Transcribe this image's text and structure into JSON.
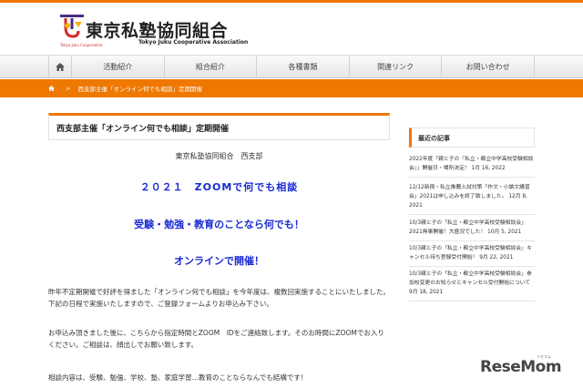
{
  "header": {
    "logo_title": "東京私塾協同組合",
    "logo_subtitle": "Tokyo Juku Cooperative Association",
    "logo_tag": "Tokyo Juku Cooperative"
  },
  "nav": {
    "home_icon": "home-icon",
    "items": [
      {
        "label": "活動紹介"
      },
      {
        "label": "組合紹介"
      },
      {
        "label": "各種書類"
      },
      {
        "label": "関連リンク"
      },
      {
        "label": "お問い合わせ"
      }
    ]
  },
  "breadcrumb": {
    "separator": ">",
    "current": "西支部主催「オンライン何でも相談」定期開催"
  },
  "article": {
    "title": "西支部主催「オンライン何でも相談」定期開催",
    "org": "東京私塾協同組合　西支部",
    "headline1": "２０２１　ZOOMで何でも相談",
    "headline2": "受験・勉強・教育のことなら何でも！",
    "headline3": "オンラインで開催！",
    "para1": "昨年不定期開催で好評を得ました「オンライン何でも相談」を今年度は、複数回実施することにいたしました。下記の日程で実施いたしますので、ご登録フォームよりお申込み下さい。",
    "para2": "お申込み頂きました後に、こちらから指定時間とZOOM　IDをご連絡致します。そのお時間にZOOMでお入りください。ご相談は、顔出しでお願い致します。",
    "para3": "相談内容は、受験、勉強、学校、塾、家庭学習…教育のことならなんでも結構です！"
  },
  "sidebar": {
    "title": "最近の記事",
    "items": [
      {
        "text": "2022年度「親と子の『私立・都立中学高校受験相談会』」開催日・場所決定！ 1月 16, 2022"
      },
      {
        "text": "12/12新宿・私立推薦入試対策「作文・小論文講習会」2021は申し込みを終了致しました。 12月 8, 2021"
      },
      {
        "text": "10/3親と子の「私立・都立中学高校受験相談会」2021無事開催！大盛況でした！ 10月 5, 2021"
      },
      {
        "text": "10/3親と子の「私立・都立中学高校受験相談会」キャンセル待ち登録受付開始！ 9月 22, 2021"
      },
      {
        "text": "10/3親と子の「私立・都立中学高校受験相談会」参加校変更のお知らせとキャンセル受付開始について 9月 18, 2021"
      }
    ]
  },
  "watermark": {
    "text": "ReseMom",
    "small": "リセマム"
  },
  "colors": {
    "accent": "#ee7800",
    "headline": "#1a2bd4"
  }
}
